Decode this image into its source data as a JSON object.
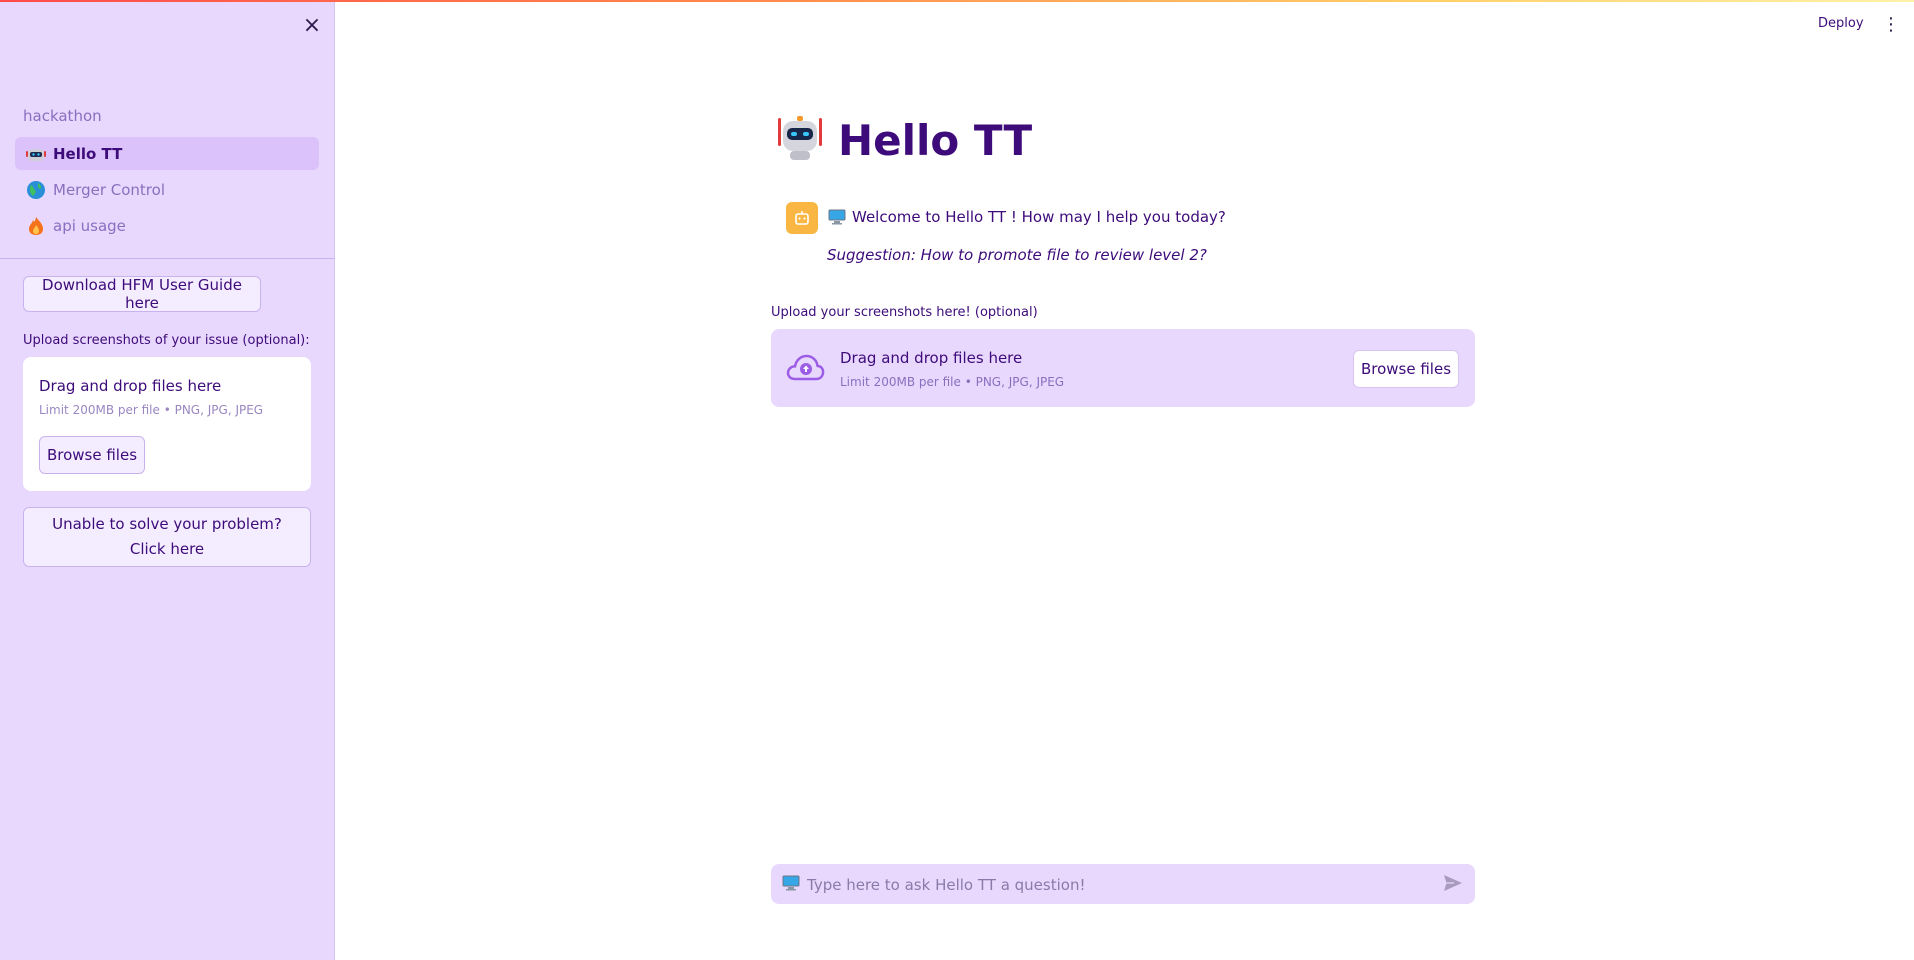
{
  "sidebar": {
    "close_label": "×",
    "section_title": "hackathon",
    "nav": [
      {
        "label": "Hello TT",
        "icon": "robot-icon",
        "active": true
      },
      {
        "label": "Merger Control",
        "icon": "globe-icon",
        "active": false
      },
      {
        "label": "api usage",
        "icon": "fire-icon",
        "active": false
      }
    ],
    "guide_button": "Download HFM User Guide here",
    "upload_label": "Upload screenshots of your issue (optional):",
    "upload_title": "Drag and drop files here",
    "upload_limit": "Limit 200MB per file • PNG, JPG, JPEG",
    "browse_button": "Browse files",
    "unable_button": "Unable to solve your problem? Click here"
  },
  "header": {
    "deploy_label": "Deploy",
    "menu_icon": "kebab-menu-icon"
  },
  "main": {
    "title": "Hello TT",
    "welcome": "Welcome to Hello TT ! How may I help you today?",
    "suggestion": "Suggestion: How to promote file to review level 2?",
    "upload_label": "Upload your screenshots here! (optional)",
    "upload_title": "Drag and drop files here",
    "upload_limit": "Limit 200MB per file • PNG, JPG, JPEG",
    "browse_button": "Browse files"
  },
  "chat_input": {
    "placeholder": "Type here to ask Hello TT a question!"
  },
  "colors": {
    "sidebar_bg": "#e9d8fd",
    "text_primary": "#3d0b7a",
    "accent": "#9b5de5",
    "avatar_bg": "#f9b643"
  }
}
